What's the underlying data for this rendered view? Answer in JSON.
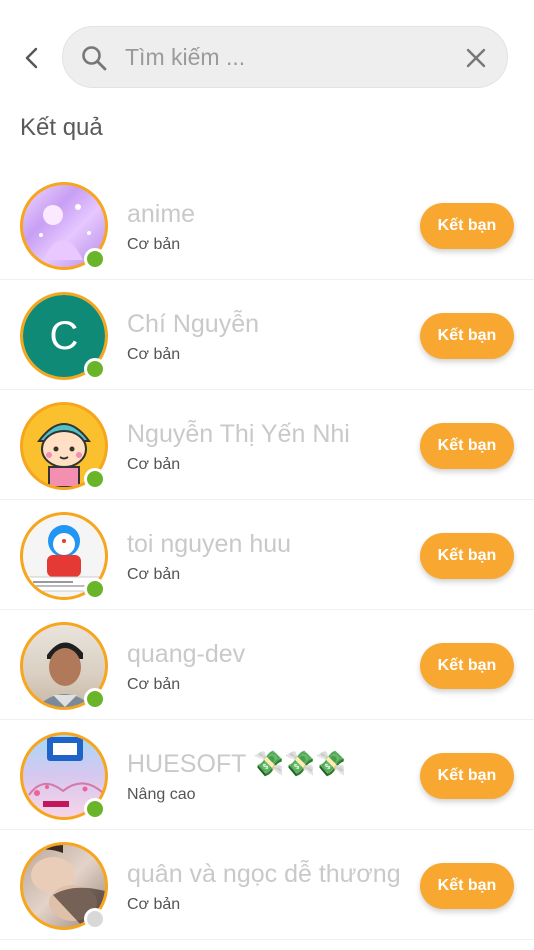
{
  "search": {
    "placeholder": "Tìm kiếm ..."
  },
  "section_title": "Kết quả",
  "results": [
    {
      "name": "anime",
      "subtitle": "Cơ bản",
      "button": "Kết bạn",
      "online": true
    },
    {
      "name": "Chí Nguyễn",
      "subtitle": "Cơ bản",
      "button": "Kết bạn",
      "online": true,
      "avatar_letter": "C"
    },
    {
      "name": "Nguyễn Thị Yến Nhi",
      "subtitle": "Cơ bản",
      "button": "Kết bạn",
      "online": true
    },
    {
      "name": "toi nguyen huu",
      "subtitle": "Cơ bản",
      "button": "Kết bạn",
      "online": true
    },
    {
      "name": "quang-dev",
      "subtitle": "Cơ bản",
      "button": "Kết bạn",
      "online": true
    },
    {
      "name": "HUESOFT 💸💸💸",
      "subtitle": "Nâng cao",
      "button": "Kết bạn",
      "online": true
    },
    {
      "name": "quân và ngọc dễ thương",
      "subtitle": "Cơ bản",
      "button": "Kết bạn",
      "online": false
    }
  ],
  "colors": {
    "accent": "#f8a830",
    "online": "#6ab42a",
    "offline": "#d8d8d8",
    "avatar_border": "#f7a51d"
  },
  "icons": [
    "back-icon",
    "search-icon",
    "clear-icon"
  ]
}
